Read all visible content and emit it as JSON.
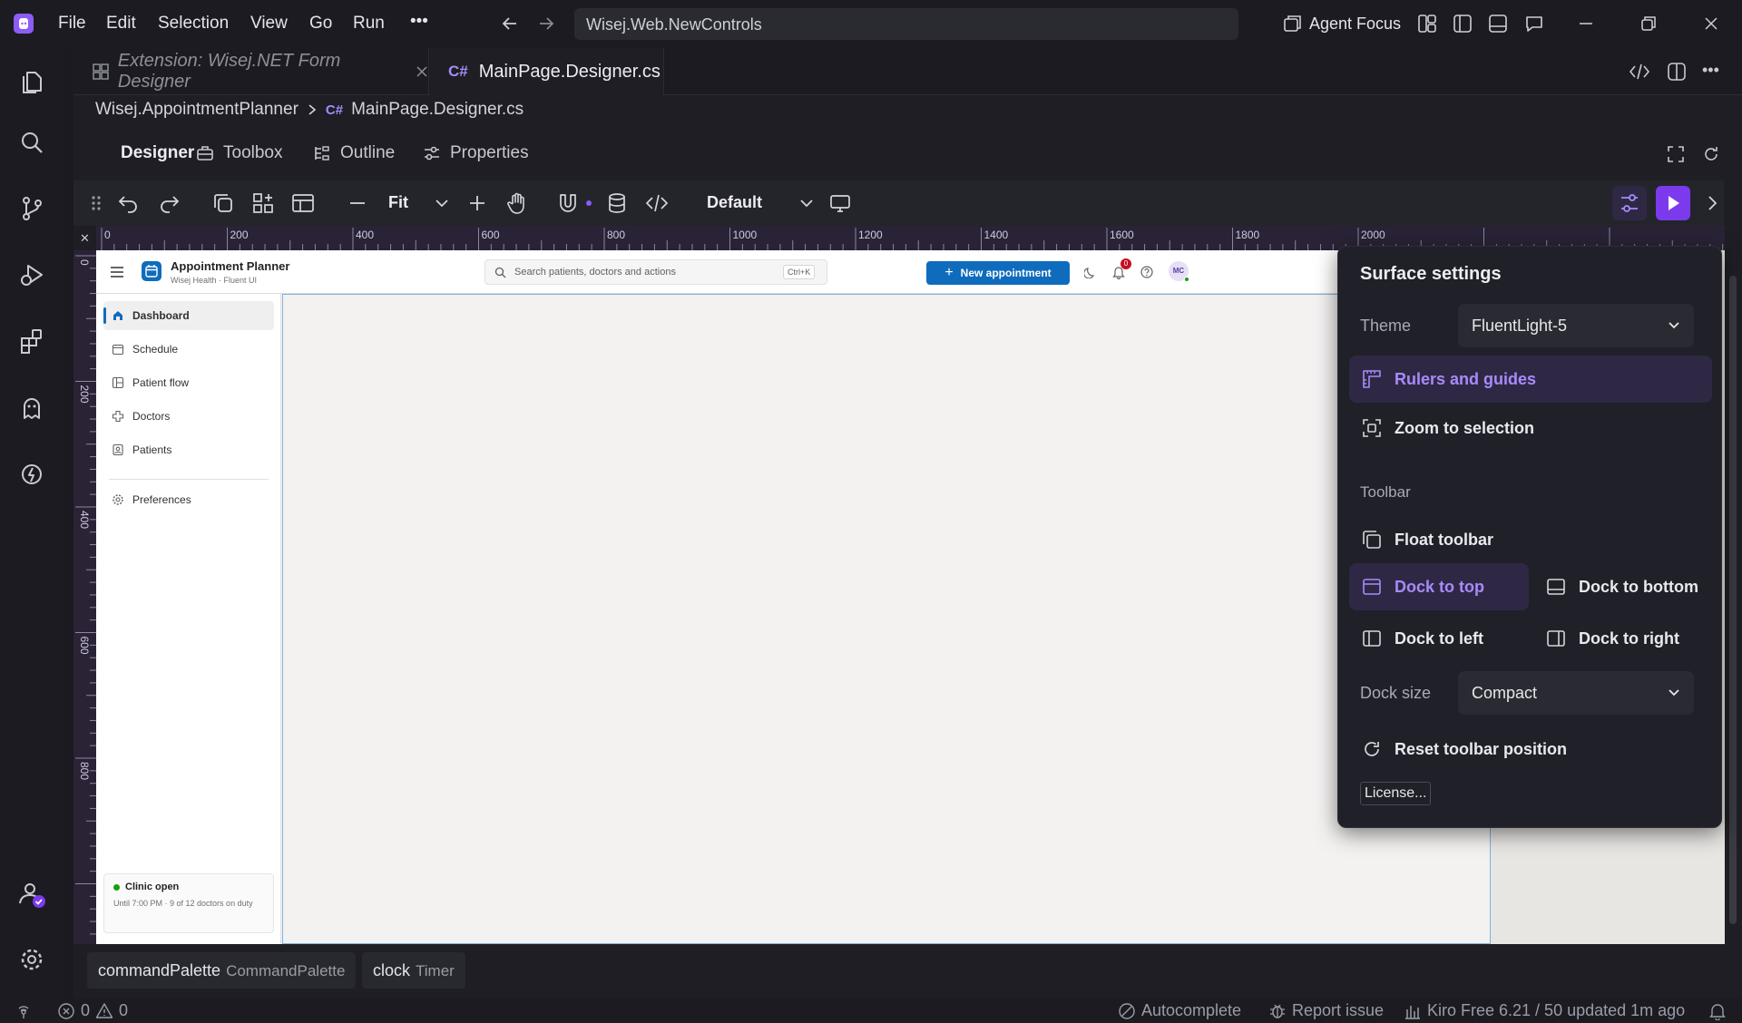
{
  "menu": {
    "items": [
      "File",
      "Edit",
      "Selection",
      "View",
      "Go",
      "Run"
    ],
    "more": "•••"
  },
  "address": "Wisej.Web.NewControls",
  "titlebar": {
    "agent_focus": "Agent Focus"
  },
  "tabs": [
    {
      "label": "Extension: Wisej.NET Form Designer",
      "active": false
    },
    {
      "label": "MainPage.Designer.cs",
      "active": true
    }
  ],
  "breadcrumb": {
    "project": "Wisej.AppointmentPlanner",
    "file": "MainPage.Designer.cs"
  },
  "view_tabs": {
    "designer": "Designer",
    "toolbox": "Toolbox",
    "outline": "Outline",
    "properties": "Properties"
  },
  "designer_toolbar": {
    "zoom": "Fit",
    "profile": "Default"
  },
  "ruler": {
    "h_ticks": [
      "0",
      "200",
      "400",
      "600",
      "800",
      "1000",
      "1200",
      "1400",
      "1600",
      "1800",
      "2000"
    ],
    "v_ticks": [
      "0",
      "200",
      "400",
      "600",
      "800"
    ]
  },
  "app": {
    "title": "Appointment Planner",
    "subtitle": "Wisej Health · Fluent UI",
    "search_placeholder": "Search patients, doctors and actions",
    "search_shortcut": "Ctrl+K",
    "new_button": "New appointment",
    "notif_count": "0",
    "avatar": "MC",
    "nav": [
      "Dashboard",
      "Schedule",
      "Patient flow",
      "Doctors",
      "Patients"
    ],
    "preferences": "Preferences",
    "status_title": "Clinic open",
    "status_text": "Until 7:00 PM · 9 of 12 doctors on duty"
  },
  "panel": {
    "title": "Surface settings",
    "theme_label": "Theme",
    "theme_value": "FluentLight-5",
    "rulers": "Rulers and guides",
    "zoom_selection": "Zoom to selection",
    "toolbar_label": "Toolbar",
    "float": "Float toolbar",
    "dock_top": "Dock to top",
    "dock_bottom": "Dock to bottom",
    "dock_left": "Dock to left",
    "dock_right": "Dock to right",
    "dock_size_label": "Dock size",
    "dock_size_value": "Compact",
    "reset": "Reset toolbar position",
    "license": "License..."
  },
  "components": [
    {
      "name": "commandPalette",
      "type": "CommandPalette"
    },
    {
      "name": "clock",
      "type": "Timer"
    }
  ],
  "status": {
    "errors": "0",
    "warnings": "0",
    "autocomplete": "Autocomplete",
    "report": "Report issue",
    "kiro": "Kiro Free 6.21 / 50 updated 1m ago"
  },
  "colors": {
    "accent": "#8b5cf6",
    "app_primary": "#0f6cbd"
  }
}
